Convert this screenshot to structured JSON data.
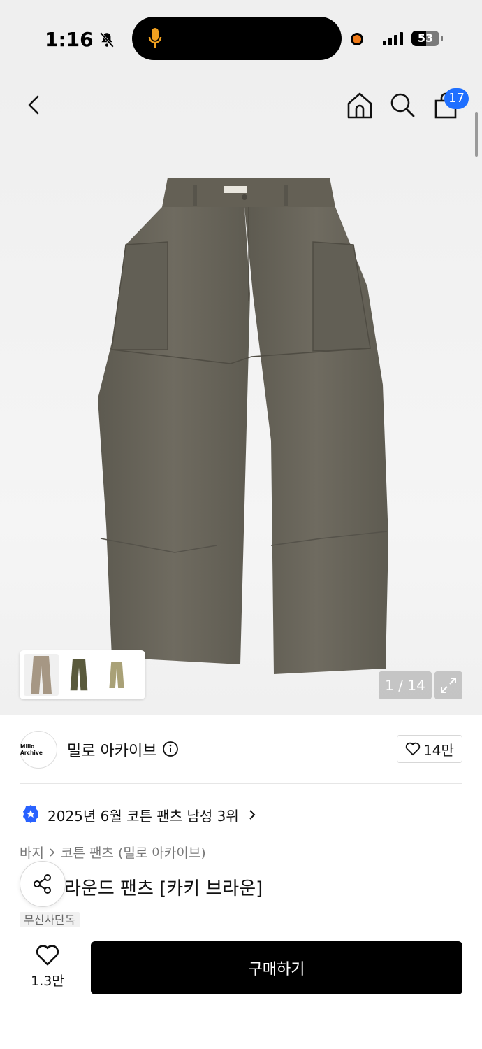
{
  "status_bar": {
    "time": "1:16",
    "battery": "53",
    "icons": [
      "bell-off-icon",
      "mic-icon",
      "signal-icon",
      "battery-icon"
    ]
  },
  "header": {
    "cart_count": "17",
    "icons": [
      "back-icon",
      "home-icon",
      "search-icon",
      "cart-icon"
    ]
  },
  "gallery": {
    "page_counter": "1 / 14",
    "expand_icon": "expand-icon",
    "main_color": "#6e6a5f"
  },
  "brand": {
    "logo_text": "Millo Archive",
    "name": "밀로 아카이브",
    "like_count": "14만"
  },
  "ranking": {
    "text": "2025년 6월 코튼 팬츠 남성 3위",
    "badge_color": "#2962ff"
  },
  "breadcrumb": {
    "level1": "바지",
    "level2": "코튼 팬츠 (밀로 아카이브)"
  },
  "product": {
    "title": "라운드 팬츠 [카키 브라운]",
    "tag": "무신사단독"
  },
  "bottom_bar": {
    "like_count": "1.3만",
    "buy_label": "구매하기"
  }
}
